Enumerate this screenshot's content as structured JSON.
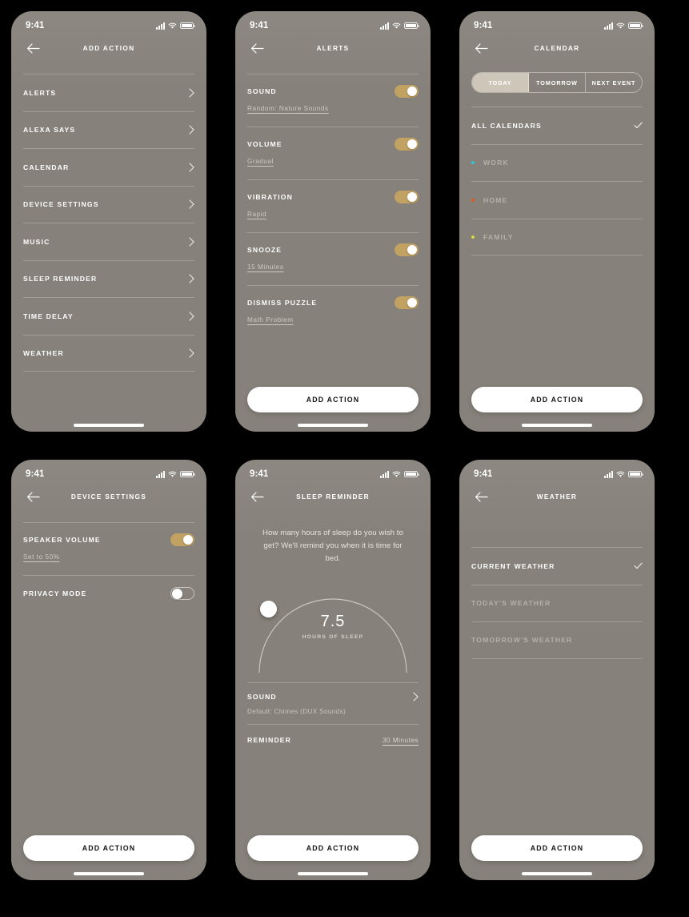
{
  "theme": {
    "background": "#000000",
    "screen_bg": "#86817a",
    "accent_gold": "#c2a263",
    "cta_bg": "#ffffff",
    "cta_text": "#141414",
    "divider": "rgba(255,255,255,.22)",
    "segment_active_bg": "#cfc6ba"
  },
  "status_bar": {
    "time": "9:41",
    "signal_icon": "signal-bars-icon",
    "wifi_icon": "wifi-icon",
    "battery_icon": "battery-icon"
  },
  "common": {
    "back_icon": "back-arrow-icon",
    "chevron_icon": "chevron-right-icon",
    "check_icon": "checkmark-icon",
    "cta_label": "ADD ACTION"
  },
  "screens": [
    {
      "id": "add-action",
      "title": "ADD ACTION",
      "items": [
        {
          "label": "ALERTS"
        },
        {
          "label": "ALEXA SAYS"
        },
        {
          "label": "CALENDAR"
        },
        {
          "label": "DEVICE SETTINGS"
        },
        {
          "label": "MUSIC"
        },
        {
          "label": "SLEEP REMINDER"
        },
        {
          "label": "TIME DELAY"
        },
        {
          "label": "WEATHER"
        }
      ]
    },
    {
      "id": "alerts",
      "title": "ALERTS",
      "cta_label": "ADD ACTION",
      "rows": [
        {
          "label": "SOUND",
          "value": "Random: Nature Sounds",
          "toggle": "on"
        },
        {
          "label": "VOLUME",
          "value": "Gradual",
          "toggle": "on"
        },
        {
          "label": "VIBRATION",
          "value": "Rapid",
          "toggle": "on"
        },
        {
          "label": "SNOOZE",
          "value": "15 Minutes",
          "toggle": "on"
        },
        {
          "label": "DISMISS PUZZLE",
          "value": "Math Problem",
          "toggle": "on"
        }
      ]
    },
    {
      "id": "calendar",
      "title": "CALENDAR",
      "cta_label": "ADD ACTION",
      "segments": [
        {
          "label": "TODAY",
          "selected": true
        },
        {
          "label": "TOMORROW",
          "selected": false
        },
        {
          "label": "NEXT EVENT",
          "selected": false
        }
      ],
      "rows": [
        {
          "label": "ALL CALENDARS",
          "selected": true,
          "dot": null
        },
        {
          "label": "WORK",
          "selected": false,
          "dot": "#2ec4d6"
        },
        {
          "label": "HOME",
          "selected": false,
          "dot": "#e2571e"
        },
        {
          "label": "FAMILY",
          "selected": false,
          "dot": "#d8d93a"
        }
      ]
    },
    {
      "id": "device-settings",
      "title": "DEVICE SETTINGS",
      "cta_label": "ADD ACTION",
      "rows": [
        {
          "label": "SPEAKER VOLUME",
          "value": "Set to 50%",
          "toggle": "on"
        },
        {
          "label": "PRIVACY MODE",
          "value": "",
          "toggle": "off"
        }
      ]
    },
    {
      "id": "sleep-reminder",
      "title": "SLEEP REMINDER",
      "cta_label": "ADD ACTION",
      "prompt": "How many hours of sleep do you wish to get? We'll remind you when it is time for bed.",
      "dial_value": "7.5",
      "dial_caption": "HOURS OF SLEEP",
      "rows": [
        {
          "label": "SOUND",
          "sub": "Default: Chimes (DUX Sounds)",
          "chevron": true
        },
        {
          "label": "REMINDER",
          "value": "30 Minutes"
        }
      ]
    },
    {
      "id": "weather",
      "title": "WEATHER",
      "cta_label": "ADD ACTION",
      "rows": [
        {
          "label": "CURRENT WEATHER",
          "selected": true
        },
        {
          "label": "TODAY'S WEATHER",
          "selected": false
        },
        {
          "label": "TOMORROW'S WEATHER",
          "selected": false
        }
      ]
    }
  ]
}
